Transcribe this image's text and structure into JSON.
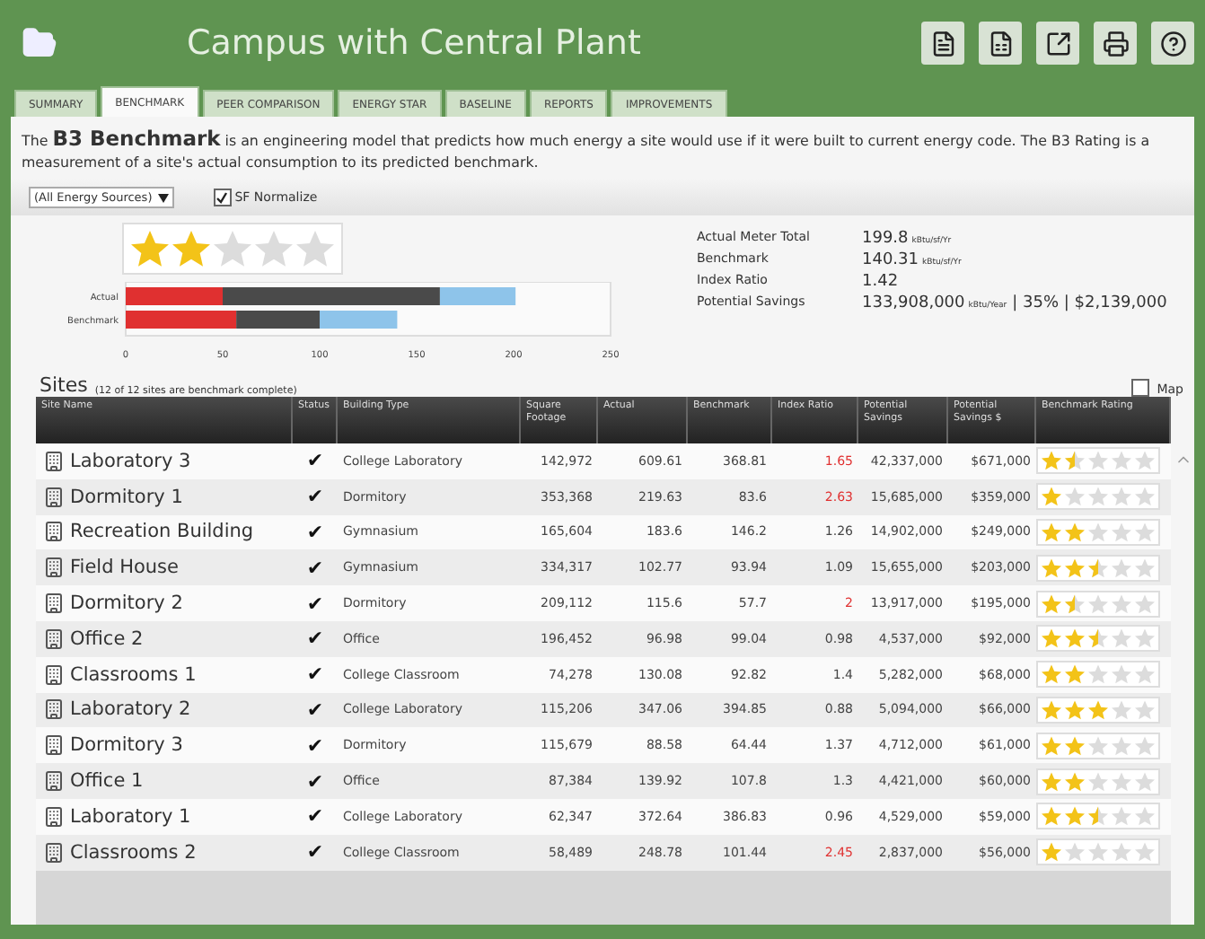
{
  "window": {
    "title": "Campus with Central Plant"
  },
  "tabs": [
    {
      "label": "SUMMARY",
      "selected": false
    },
    {
      "label": "BENCHMARK",
      "selected": true
    },
    {
      "label": "PEER COMPARISON",
      "selected": false
    },
    {
      "label": "ENERGY STAR",
      "selected": false
    },
    {
      "label": "BASELINE",
      "selected": false
    },
    {
      "label": "REPORTS",
      "selected": false
    },
    {
      "label": "IMPROVEMENTS",
      "selected": false
    }
  ],
  "intro": "The **B3 Benchmark** is an engineering model that predicts how much energy a site would use if it were built to current energy code. The B3 Rating is a measurement of a site's actual consumption to its predicted benchmark.",
  "filters": {
    "source": "(All Energy Sources)",
    "sf_normalize": {
      "label": "SF Normalize",
      "checked": true
    }
  },
  "rating": {
    "stars": 2
  },
  "chart_data": {
    "type": "bar",
    "orientation": "horizontal",
    "stacked": true,
    "categories": [
      "Actual",
      "Benchmark"
    ],
    "series": [
      {
        "color": "#e03030",
        "values": [
          50,
          57
        ]
      },
      {
        "color": "#4a4a4a",
        "values": [
          112,
          43
        ]
      },
      {
        "color": "#8ec4ea",
        "values": [
          39,
          40
        ]
      }
    ],
    "xlim": [
      0,
      250
    ],
    "xticks": [
      0,
      50,
      100,
      150,
      200,
      250
    ]
  },
  "summary": [
    {
      "label": "Actual Meter Total",
      "value": "199.8",
      "unit": "kBtu/sf/Yr"
    },
    {
      "label": "Benchmark",
      "value": "140.31",
      "unit": "kBtu/sf/Yr"
    },
    {
      "label": "Index Ratio",
      "value": "1.42"
    },
    {
      "label": "Potential Savings",
      "value": "133,908,000",
      "unit": "kBtu/Year",
      "extra": "| 35% | $2,139,000"
    }
  ],
  "sites": {
    "title": "Sites",
    "note": "(12 of 12 sites are benchmark complete)",
    "map": {
      "label": "Map",
      "checked": false
    },
    "columns": [
      "Site Name",
      "Status",
      "Building Type",
      "Square Footage",
      "Actual",
      "Benchmark",
      "Index Ratio",
      "Potential Savings",
      "Potential Savings $",
      "Benchmark Rating"
    ],
    "rows": [
      {
        "name": "Laboratory 3",
        "status": "✔",
        "type": "College Laboratory",
        "sqft": "142,972",
        "actual": "609.61",
        "benchmark": "368.81",
        "ratio": "1.65",
        "alert": true,
        "savings": "42,337,000",
        "dollars": "$671,000",
        "stars": 1.5
      },
      {
        "name": "Dormitory 1",
        "status": "✔",
        "type": "Dormitory",
        "sqft": "353,368",
        "actual": "219.63",
        "benchmark": "83.6",
        "ratio": "2.63",
        "alert": true,
        "savings": "15,685,000",
        "dollars": "$359,000",
        "stars": 1
      },
      {
        "name": "Recreation Building",
        "status": "✔",
        "type": "Gymnasium",
        "sqft": "165,604",
        "actual": "183.6",
        "benchmark": "146.2",
        "ratio": "1.26",
        "alert": false,
        "savings": "14,902,000",
        "dollars": "$249,000",
        "stars": 2
      },
      {
        "name": "Field House",
        "status": "✔",
        "type": "Gymnasium",
        "sqft": "334,317",
        "actual": "102.77",
        "benchmark": "93.94",
        "ratio": "1.09",
        "alert": false,
        "savings": "15,655,000",
        "dollars": "$203,000",
        "stars": 2.5
      },
      {
        "name": "Dormitory 2",
        "status": "✔",
        "type": "Dormitory",
        "sqft": "209,112",
        "actual": "115.6",
        "benchmark": "57.7",
        "ratio": "2",
        "alert": true,
        "savings": "13,917,000",
        "dollars": "$195,000",
        "stars": 1.5
      },
      {
        "name": "Office 2",
        "status": "✔",
        "type": "Office",
        "sqft": "196,452",
        "actual": "96.98",
        "benchmark": "99.04",
        "ratio": "0.98",
        "alert": false,
        "savings": "4,537,000",
        "dollars": "$92,000",
        "stars": 2.5
      },
      {
        "name": "Classrooms 1",
        "status": "✔",
        "type": "College Classroom",
        "sqft": "74,278",
        "actual": "130.08",
        "benchmark": "92.82",
        "ratio": "1.4",
        "alert": false,
        "savings": "5,282,000",
        "dollars": "$68,000",
        "stars": 2
      },
      {
        "name": "Laboratory 2",
        "status": "✔",
        "type": "College Laboratory",
        "sqft": "115,206",
        "actual": "347.06",
        "benchmark": "394.85",
        "ratio": "0.88",
        "alert": false,
        "savings": "5,094,000",
        "dollars": "$66,000",
        "stars": 3
      },
      {
        "name": "Dormitory 3",
        "status": "✔",
        "type": "Dormitory",
        "sqft": "115,679",
        "actual": "88.58",
        "benchmark": "64.44",
        "ratio": "1.37",
        "alert": false,
        "savings": "4,712,000",
        "dollars": "$61,000",
        "stars": 2
      },
      {
        "name": "Office 1",
        "status": "✔",
        "type": "Office",
        "sqft": "87,384",
        "actual": "139.92",
        "benchmark": "107.8",
        "ratio": "1.3",
        "alert": false,
        "savings": "4,421,000",
        "dollars": "$60,000",
        "stars": 2
      },
      {
        "name": "Laboratory 1",
        "status": "✔",
        "type": "College Laboratory",
        "sqft": "62,347",
        "actual": "372.64",
        "benchmark": "386.83",
        "ratio": "0.96",
        "alert": false,
        "savings": "4,529,000",
        "dollars": "$59,000",
        "stars": 2.5
      },
      {
        "name": "Classrooms 2",
        "status": "✔",
        "type": "College Classroom",
        "sqft": "58,489",
        "actual": "248.78",
        "benchmark": "101.44",
        "ratio": "2.45",
        "alert": true,
        "savings": "2,837,000",
        "dollars": "$56,000",
        "stars": 1
      }
    ]
  }
}
